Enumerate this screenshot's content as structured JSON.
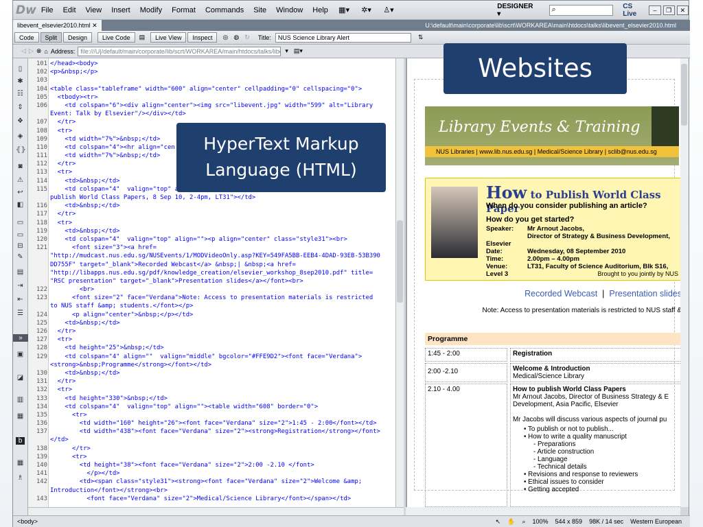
{
  "app": {
    "logo": "Dw",
    "menus": [
      "File",
      "Edit",
      "View",
      "Insert",
      "Modify",
      "Format",
      "Commands",
      "Site",
      "Window",
      "Help"
    ],
    "workspace": "DESIGNER",
    "cslive": "CS Live"
  },
  "document": {
    "tab": "libevent_elsevier2010.html",
    "path": "U:\\default\\main\\corporate\\lib\\scrt\\WORKAREA\\main\\htdocs\\talks\\libevent_elsevier2010.html"
  },
  "toolbar": {
    "code": "Code",
    "split": "Split",
    "design": "Design",
    "live_code": "Live Code",
    "live_view": "Live View",
    "inspect": "Inspect",
    "title_label": "Title:",
    "title_value": "NUS Science Library Alert"
  },
  "address": {
    "label": "Address:",
    "value": "file:///U|/default/main/corporate/lib/scrt/WORKAREA/main/htdocs/talks/libevent"
  },
  "callouts": {
    "html": [
      "HyperText Markup",
      "Language (HTML)"
    ],
    "websites": "Websites"
  },
  "code_lines": [
    {
      "n": "101",
      "t": "</head><body>"
    },
    {
      "n": "102",
      "t": "<p>&nbsp;</p>"
    },
    {
      "n": "103",
      "t": ""
    },
    {
      "n": "104",
      "t": "<table class=\"tableframe\" width=\"600\" align=\"center\" cellpadding=\"0\" cellspacing=\"0\">"
    },
    {
      "n": "105",
      "t": "  <tbody><tr>"
    },
    {
      "n": "106",
      "t": "    <td colspan=\"6\"><div align=\"center\"><img src=\"libevent.jpg\" width=\"599\" alt=\"Library"
    },
    {
      "n": "",
      "t": "Event: Talk by Elsevier\"/></div></td>"
    },
    {
      "n": "107",
      "t": "  </tr>"
    },
    {
      "n": "108",
      "t": "  <tr>"
    },
    {
      "n": "109",
      "t": "    <td width=\"7%\">&nbsp;</td>"
    },
    {
      "n": "110",
      "t": "    <td colspan=\"4\"><hr align=\"cen"
    },
    {
      "n": "111",
      "t": "    <td width=\"7%\">&nbsp;</td>"
    },
    {
      "n": "112",
      "t": "  </tr>"
    },
    {
      "n": "113",
      "t": "  <tr>"
    },
    {
      "n": "114",
      "t": "    <td>&nbsp;</td>"
    },
    {
      "n": "115",
      "t": "    <td colspan=\"4\"  valign=\"top\" a"
    },
    {
      "n": "",
      "t": "publish World Class Papers, 8 Sep 10, 2-4pm, LT31\"></td>"
    },
    {
      "n": "116",
      "t": "    <td>&nbsp;</td>"
    },
    {
      "n": "117",
      "t": "  </tr>"
    },
    {
      "n": "118",
      "t": "  <tr>"
    },
    {
      "n": "119",
      "t": "    <td>&nbsp;</td>"
    },
    {
      "n": "120",
      "t": "    <td colspan=\"4\"  valign=\"top\" align=\"\"><p align=\"center\" class=\"style31\"><br>"
    },
    {
      "n": "121",
      "t": "      <font size=\"3\"><a href="
    },
    {
      "n": "",
      "t": "\"http://mudcast.nus.edu.sg/NUSEvents/1/MODVideoOnly.asp?KEY=549FA5BB-EEB4-4DAD-93EB-53B390"
    },
    {
      "n": "",
      "t": "DD755F\" target=\"_blank\">Recorded Webcast</a> &nbsp;| &nbsp;<a href="
    },
    {
      "n": "",
      "t": "\"http://libapps.nus.edu.sg/pdf/knowledge_creation/elsevier_workshop_8sep2010.pdf\" title="
    },
    {
      "n": "",
      "t": "\"RSC presentation\" target=\"_blank\">Presentation slides</a></font><br>"
    },
    {
      "n": "122",
      "t": "        <br>"
    },
    {
      "n": "123",
      "t": "      <font size=\"2\" face=\"Verdana\">Note: Access to presentation materials is restricted"
    },
    {
      "n": "",
      "t": "to NUS staff &amp; students.</font></p>"
    },
    {
      "n": "124",
      "t": "      <p align=\"center\">&nbsp;</p></td>"
    },
    {
      "n": "125",
      "t": "    <td>&nbsp;</td>"
    },
    {
      "n": "126",
      "t": "  </tr>"
    },
    {
      "n": "127",
      "t": "  <tr>"
    },
    {
      "n": "128",
      "t": "    <td height=\"25\">&nbsp;</td>"
    },
    {
      "n": "129",
      "t": "    <td colspan=\"4\" align=\"\"  valign=\"middle\" bgcolor=\"#FFE9D2\"><font face=\"Verdana\">"
    },
    {
      "n": "",
      "t": "<strong>&nbsp;Programme</strong></font></td>"
    },
    {
      "n": "130",
      "t": "    <td>&nbsp;</td>"
    },
    {
      "n": "131",
      "t": "  </tr>"
    },
    {
      "n": "132",
      "t": "  <tr>"
    },
    {
      "n": "133",
      "t": "    <td height=\"330\">&nbsp;</td>"
    },
    {
      "n": "134",
      "t": "    <td colspan=\"4\"  valign=\"top\" align=\"\"><table width=\"608\" border=\"0\">"
    },
    {
      "n": "135",
      "t": "      <tr>"
    },
    {
      "n": "136",
      "t": "        <td width=\"160\" height=\"26\"><font face=\"Verdana\" size=\"2\">1:45 - 2:00</font></td>"
    },
    {
      "n": "137",
      "t": "        <td width=\"438\"><font face=\"Verdana\" size=\"2\"><strong>Registration</strong></font>"
    },
    {
      "n": "",
      "t": "</td>"
    },
    {
      "n": "138",
      "t": "      </tr>"
    },
    {
      "n": "139",
      "t": "      <tr>"
    },
    {
      "n": "140",
      "t": "        <td height=\"38\"><font face=\"Verdana\" size=\"2\">2:00 -2.10 </font>"
    },
    {
      "n": "141",
      "t": "          </p></td>"
    },
    {
      "n": "142",
      "t": "        <td><span class=\"style31\"><strong><font face=\"Verdana\" size=\"2\">Welcome &amp;"
    },
    {
      "n": "",
      "t": "Introduction</font></strong><br>"
    },
    {
      "n": "143",
      "t": "          <font face=\"Verdana\" size=\"2\">Medical/Science Library</font></span></td>"
    }
  ],
  "page": {
    "banner_title": "Library Events & Training",
    "banner_strip": "NUS Libraries  |  www.lib.nus.edu.sg  |  Medical/Science Library  |  sclib@nus.edu.sg",
    "hero_how": "How",
    "hero_rest": " to Publish World Class Paper",
    "hero_q1": "When do you consider publishing an article?",
    "hero_q2": "How do you get started?",
    "meta": [
      {
        "k": "Speaker:",
        "v": "Mr Arnout Jacobs,"
      },
      {
        "k": "",
        "v": "Director of Strategy & Business Development, Elsevier"
      },
      {
        "k": "Date:",
        "v": "Wednesday, 08 September 2010"
      },
      {
        "k": "Time:",
        "v": "2.00pm – 4.00pm"
      },
      {
        "k": "Venue:",
        "v": "LT31, Faculty of Science Auditorium, Blk S16, Level 3"
      }
    ],
    "brought": "Brought to you jointly by NUS",
    "link_webcast": "Recorded Webcast",
    "link_sep": "|",
    "link_slides": "Presentation slides",
    "note": "Note: Access to presentation materials is restricted to NUS staff &",
    "programme": "Programme",
    "rows": [
      {
        "time": "1:45 - 2:00",
        "title": "Registration",
        "sub": ""
      },
      {
        "time": "2:00 -2.10",
        "title": "Welcome & Introduction",
        "sub": "Medical/Science Library"
      },
      {
        "time": "2.10 - 4.00",
        "title": "How to publish World Class Papers",
        "sub": "Mr Arnout Jacobs, Director of Business Strategy & E Development, Asia Pacific, Elsevier"
      }
    ],
    "desc": "Mr Jacobs will discuss various aspects of journal pu",
    "bullets": [
      "To publish or not to publish...",
      "How to write a quality manuscript",
      "Revisions and response to reviewers",
      "Ethical issues to consider",
      "Getting accepted"
    ],
    "sub_bullets": [
      "- Preparations",
      "- Article construction",
      "- Language",
      "- Technical details"
    ]
  },
  "status": {
    "tag": "<body>",
    "zoom": "100%",
    "size": "544 x 859",
    "weight": "98K / 14 sec",
    "encoding": "Western European"
  }
}
